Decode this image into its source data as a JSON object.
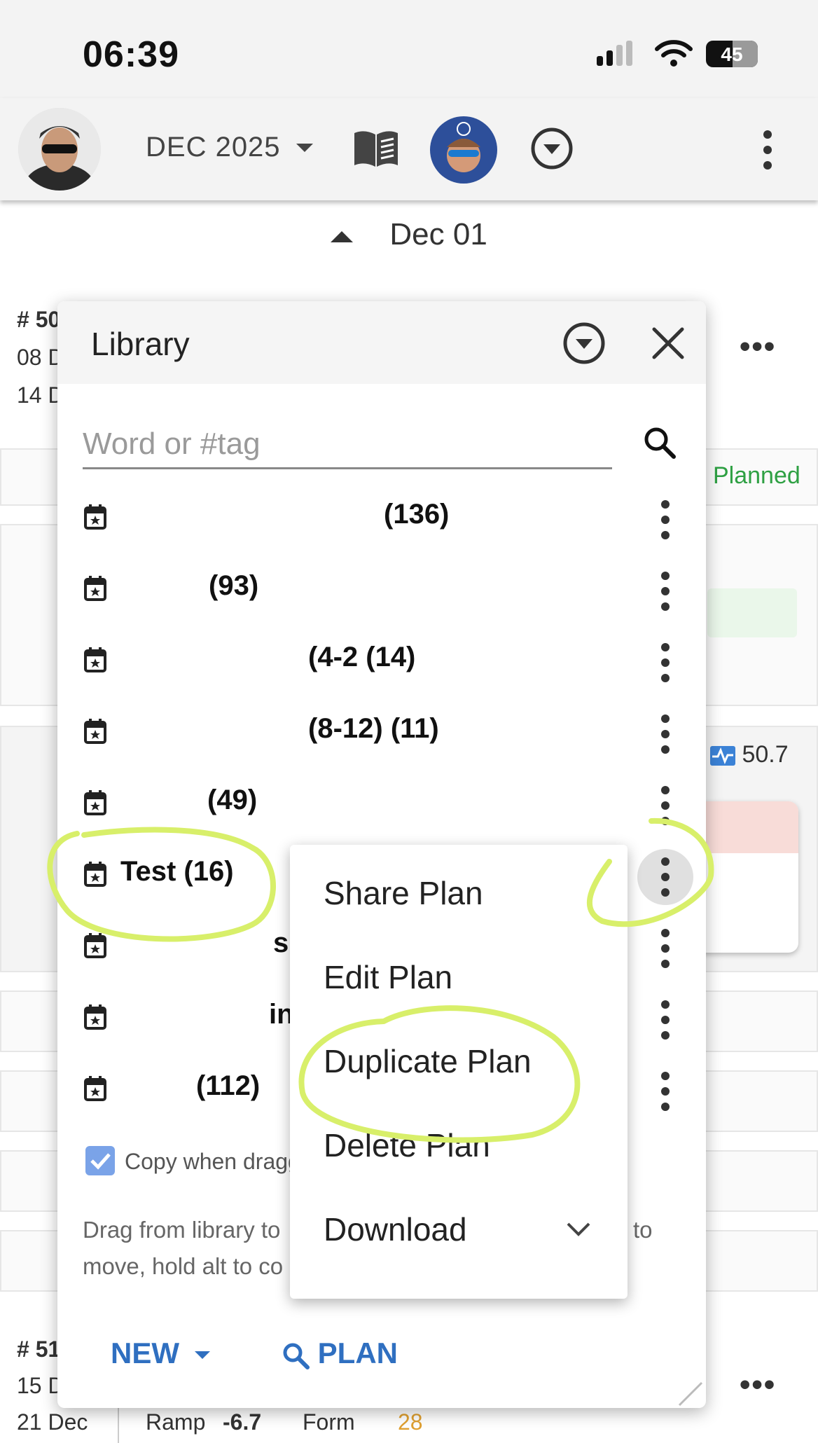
{
  "status_bar": {
    "time": "06:39",
    "battery": "45"
  },
  "toolbar": {
    "month": "DEC 2025"
  },
  "page": {
    "day": "Dec 01",
    "week_a_number": "# 50",
    "week_a_start": "08 D",
    "week_a_end": "14 D",
    "planned": "Planned",
    "fitness_value": "50.7",
    "week_b_number": "# 51",
    "week_b_start": "15 D",
    "week_b_end": "21 Dec",
    "ramp_label": "Ramp",
    "ramp_value": "-6.7",
    "form_label": "Form",
    "form_value": "28"
  },
  "library": {
    "title": "Library",
    "search_placeholder": "Word or #tag",
    "plans": [
      {
        "label": "(136)"
      },
      {
        "label": "(93)"
      },
      {
        "label": "(4-2 (14)"
      },
      {
        "label": "(8-12) (11)"
      },
      {
        "label": "(49)"
      },
      {
        "label": "Test (16)"
      },
      {
        "label": "s"
      },
      {
        "label": "in"
      },
      {
        "label": "(112)"
      }
    ],
    "copy_label": "Copy when dragg",
    "help_line1": "Drag from library to",
    "help_line1_end": "to",
    "help_line2": "move, hold alt to co",
    "new_label": "NEW",
    "plan_label": "PLAN"
  },
  "context_menu": {
    "items": [
      "Share Plan",
      "Edit Plan",
      "Duplicate Plan",
      "Delete Plan",
      "Download"
    ]
  },
  "colors": {
    "accent": "#2f6fc0",
    "planned": "#2ea043",
    "form": "#e0a030",
    "highlight": "#d8ef6a"
  }
}
